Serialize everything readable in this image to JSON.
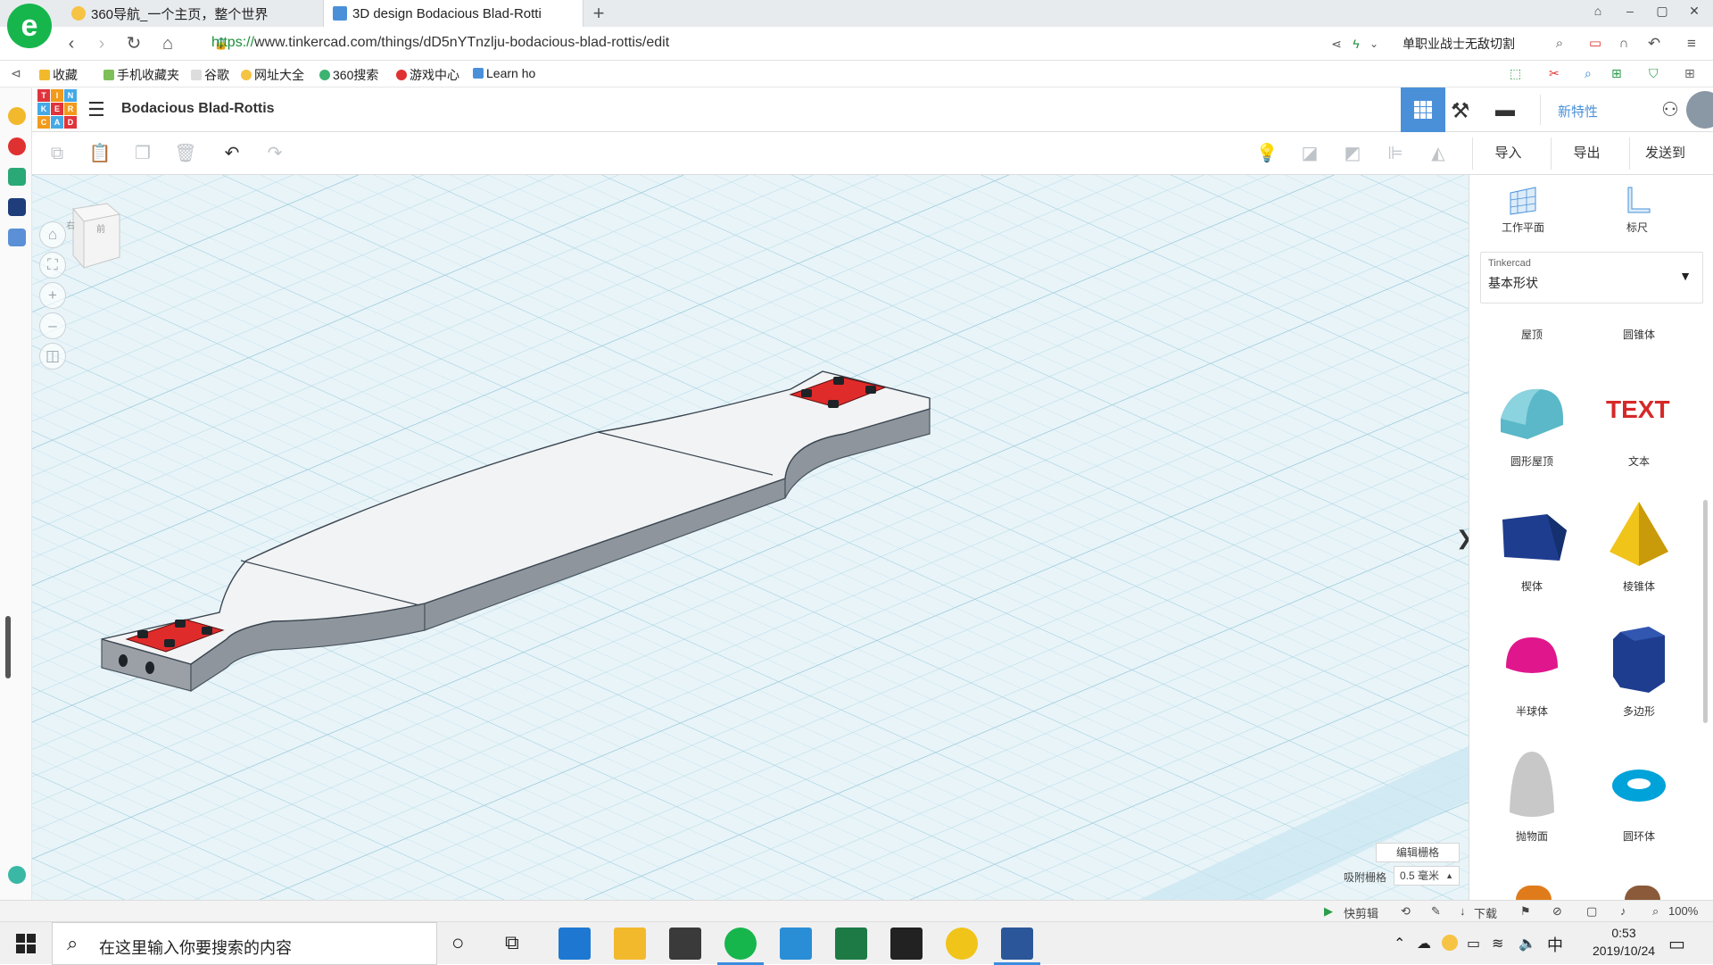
{
  "browser": {
    "tabs": [
      {
        "title": "360导航_一个主页，整个世界"
      },
      {
        "title": "3D design Bodacious Blad-Rotti"
      }
    ],
    "url_scheme": "https://",
    "url_rest": "www.tinkercad.com/things/dD5nYTnzlju-bodacious-blad-rottis/edit",
    "search_text": "单职业战士无敌切割",
    "bookmarks": [
      "收藏",
      "手机收藏夹",
      "谷歌",
      "网址大全",
      "360搜索",
      "游戏中心",
      "Learn ho"
    ]
  },
  "app": {
    "logo_letters": [
      "T",
      "I",
      "N",
      "K",
      "E",
      "R",
      "C",
      "A",
      "D"
    ],
    "title": "Bodacious Blad-Rottis",
    "new_features": "新特性",
    "actions": {
      "import": "导入",
      "export": "导出",
      "send_to": "发送到"
    }
  },
  "viewcube": {
    "left": "右",
    "front": "前"
  },
  "panel": {
    "workplane": "工作平面",
    "ruler": "标尺",
    "library_source": "Tinkercad",
    "library_name": "基本形状",
    "row0": [
      "屋顶",
      "圆锥体"
    ],
    "shapes": [
      {
        "label": "圆形屋顶",
        "icon": "round-roof-icon"
      },
      {
        "label": "文本",
        "icon": "text-shape-icon"
      },
      {
        "label": "楔体",
        "icon": "wedge-icon"
      },
      {
        "label": "棱锥体",
        "icon": "pyramid-icon"
      },
      {
        "label": "半球体",
        "icon": "half-sphere-icon"
      },
      {
        "label": "多边形",
        "icon": "polygon-icon"
      },
      {
        "label": "抛物面",
        "icon": "paraboloid-icon"
      },
      {
        "label": "圆环体",
        "icon": "torus-icon"
      }
    ],
    "text_shape_word": "TEXT"
  },
  "workplane": {
    "edit_grid": "编辑栅格",
    "snap_label": "吸附栅格",
    "snap_value": "0.5 毫米"
  },
  "statusbar": {
    "clip": "快剪辑",
    "download": "下载",
    "zoom": "100%"
  },
  "taskbar": {
    "search_placeholder": "在这里输入你要搜索的内容",
    "ime": "中",
    "time": "0:53",
    "date": "2019/10/24"
  },
  "colors": {
    "accent": "#4a90d9",
    "workplane": "#e8f4f8",
    "grid_line": "#b8dbe8",
    "part_top": "#f2f3f4",
    "part_side": "#9aa0a6",
    "board": "#e02b2b"
  }
}
